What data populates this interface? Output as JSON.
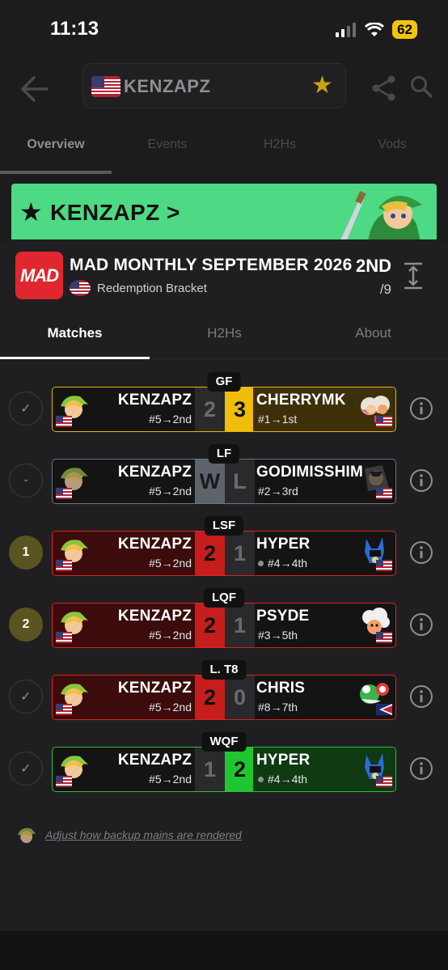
{
  "status_bar": {
    "time": "11:13",
    "battery": "62"
  },
  "header": {
    "search_name": "KENZAPZ"
  },
  "top_tabs": [
    {
      "label": "Overview"
    },
    {
      "label": "Events"
    },
    {
      "label": "H2Hs"
    },
    {
      "label": "Vods"
    }
  ],
  "banner": {
    "player_name": "KENZAPZ",
    "chevron": ">"
  },
  "event": {
    "logo_text": "MAD",
    "title": "MAD MONTHLY SEPTEMBER 2026",
    "bracket": "Redemption Bracket",
    "placing": "2ND",
    "total": "/9"
  },
  "sub_tabs": [
    {
      "label": "Matches"
    },
    {
      "label": "H2Hs"
    },
    {
      "label": "About"
    }
  ],
  "matches": [
    {
      "round": "GF",
      "status": "✓",
      "p1_name": "KENZAPZ",
      "p1_seed": "#5→2nd",
      "p1_score": "2",
      "p2_score": "3",
      "p2_name": "CHERRYMK",
      "p2_seed": "#1→1st"
    },
    {
      "round": "LF",
      "status": "-",
      "p1_name": "KENZAPZ",
      "p1_seed": "#5→2nd",
      "p1_score": "W",
      "p2_score": "L",
      "p2_name": "GODIMISSHIM",
      "p2_seed": "#2→3rd"
    },
    {
      "round": "LSF",
      "status": "1",
      "p1_name": "KENZAPZ",
      "p1_seed": "#5→2nd",
      "p1_score": "2",
      "p2_score": "1",
      "p2_name": "HYPER",
      "p2_seed": "#4→4th"
    },
    {
      "round": "LQF",
      "status": "2",
      "p1_name": "KENZAPZ",
      "p1_seed": "#5→2nd",
      "p1_score": "2",
      "p2_score": "1",
      "p2_name": "PSYDE",
      "p2_seed": "#3→5th"
    },
    {
      "round": "L. T8",
      "status": "✓",
      "p1_name": "KENZAPZ",
      "p1_seed": "#5→2nd",
      "p1_score": "2",
      "p2_score": "0",
      "p2_name": "CHRIS",
      "p2_seed": "#8→7th"
    },
    {
      "round": "WQF",
      "status": "✓",
      "p1_name": "KENZAPZ",
      "p1_seed": "#5→2nd",
      "p1_score": "1",
      "p2_score": "2",
      "p2_name": "HYPER",
      "p2_seed": "#4→4th"
    }
  ],
  "footer": {
    "link": "Adjust how backup mains are rendered"
  },
  "colors": {
    "banner": "#4ed984",
    "loss": "#c61d1d",
    "gold": "#f0bd0b",
    "green": "#20c62f",
    "star": "#c9a20f"
  }
}
